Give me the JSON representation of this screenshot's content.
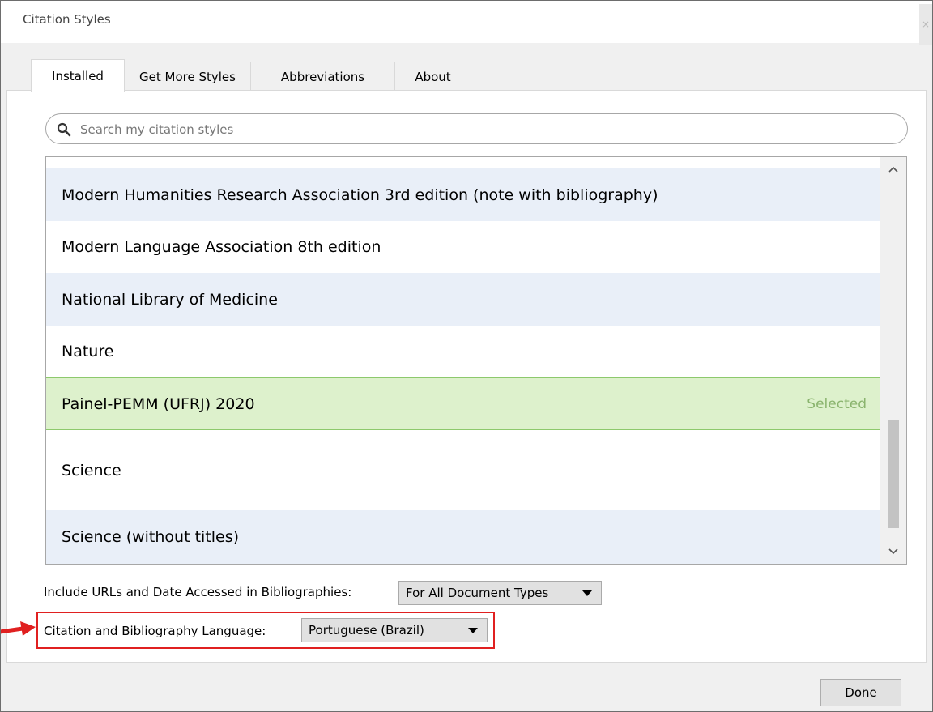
{
  "window": {
    "title": "Citation Styles",
    "close_glyph": "×"
  },
  "tabs": [
    {
      "label": "Installed",
      "active": true
    },
    {
      "label": "Get More Styles",
      "active": false
    },
    {
      "label": "Abbreviations",
      "active": false
    },
    {
      "label": "About",
      "active": false
    }
  ],
  "search": {
    "placeholder": "Search my citation styles",
    "value": "",
    "icon": "search-icon"
  },
  "styles": [
    {
      "name": "Modern Humanities Research Association 3rd edition (note with bibliography)"
    },
    {
      "name": "Modern Language Association 8th edition"
    },
    {
      "name": "National Library of Medicine"
    },
    {
      "name": "Nature"
    },
    {
      "name": "Painel-PEMM (UFRJ) 2020",
      "status": "Selected"
    },
    {
      "name": "Science"
    },
    {
      "name": "Science (without titles)"
    }
  ],
  "options": {
    "urls_label": "Include URLs and Date Accessed in Bibliographies:",
    "urls_value": "For All Document Types",
    "language_label": "Citation and Bibliography Language:",
    "language_value": "Portuguese (Brazil)"
  },
  "done_label": "Done",
  "colors": {
    "selected_row": "#ddf1cc",
    "alt_row": "#e9eff8",
    "annotation": "#e02020"
  }
}
